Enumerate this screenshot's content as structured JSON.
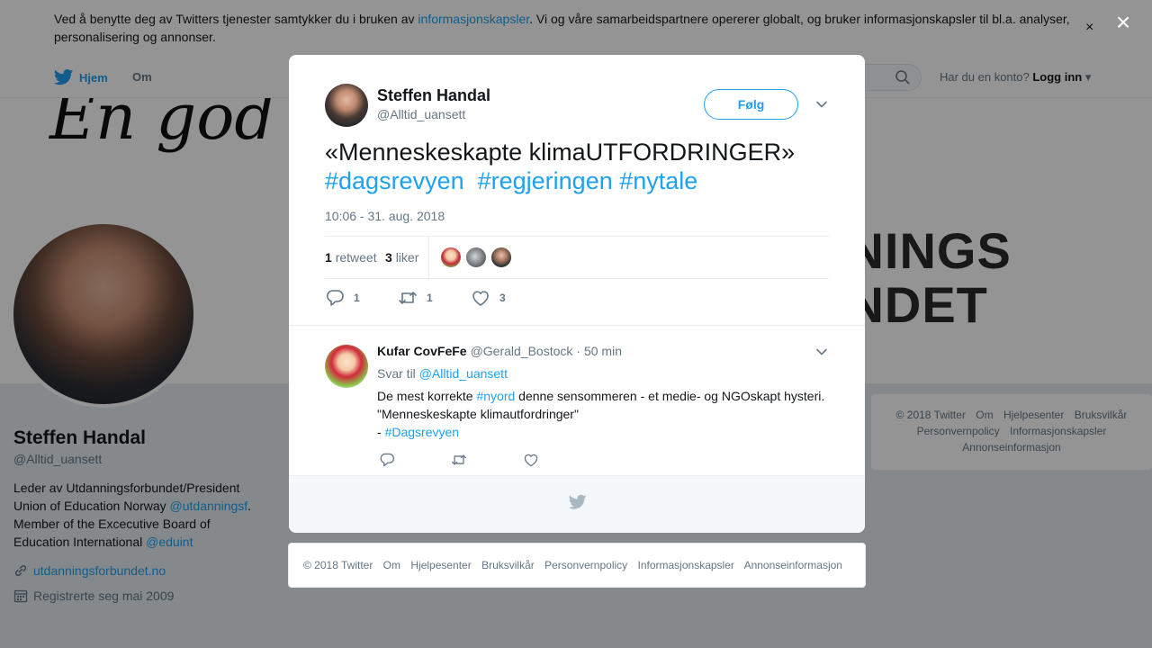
{
  "cookie_bar": {
    "text_before": "Ved å benytte deg av Twitters tjenester samtykker du i bruken av ",
    "link": "informasjonskapsler",
    "text_after": ". Vi og våre samarbeidspartnere opererer globalt, og bruker informasjonskapsler til bl.a. analyser, personalisering og annonser.",
    "close_icon": "×"
  },
  "topnav": {
    "home": "Hjem",
    "about": "Om",
    "login_prompt": "Har du en konto?",
    "login": "Logg inn"
  },
  "cover": {
    "script_text": "En god t",
    "logo_line1": "NNINGS",
    "logo_line2": "UNDET"
  },
  "profile": {
    "name": "Steffen Handal",
    "handle": "@Alltid_uansett",
    "bio_before": "Leder av Utdanningsforbundet/President Union of Education Norway ",
    "bio_link1": "@utdanningsf",
    "bio_middle": ". Member of the Excecutive Board of Education International ",
    "bio_link2": "@eduint",
    "url": "utdanningsforbundet.no",
    "joined": "Registrerte seg mai 2009"
  },
  "side_footer": [
    "© 2018 Twitter",
    "Om",
    "Hjelpesenter",
    "Bruksvilkår",
    "Personvernpolicy",
    "Informasjonskapsler",
    "Annonseinformasjon"
  ],
  "overlay": {
    "close_icon": "×"
  },
  "tweet": {
    "author_name": "Steffen Handal",
    "author_handle": "@Alltid_uansett",
    "follow_label": "Følg",
    "text_main": "«Menneskeskapte klimaUTFORDRINGER»",
    "hashtag1": "#dagsrevyen",
    "hashtag2": "#regjeringen",
    "hashtag3": "#nytale",
    "timestamp": "10:06 - 31. aug. 2018",
    "retweets_count": "1",
    "retweets_label": "retweet",
    "likes_count": "3",
    "likes_label": "liker",
    "reply_count": "1",
    "retweet_action_count": "1",
    "like_action_count": "3"
  },
  "reply": {
    "name": "Kufar CovFeFe",
    "handle": "@Gerald_Bostock",
    "time": "· 50 min",
    "reply_to_label": "Svar til",
    "reply_to_handle": "@Alltid_uansett",
    "text_before": "De mest korrekte ",
    "text_link": "#nyord",
    "text_after": " denne sensommeren - et medie- og NGOskapt hysteri. \"Menneskeskapte klimautfordringer\"",
    "line3_prefix": "- ",
    "line3_link": "#Dagsrevyen"
  },
  "modal_footer": [
    "© 2018 Twitter",
    "Om",
    "Hjelpesenter",
    "Bruksvilkår",
    "Personvernpolicy",
    "Informasjonskapsler",
    "Annonseinformasjon"
  ],
  "colors": {
    "accent": "#1da1f2",
    "secondary_text": "#657786",
    "divider": "#e6ecf0"
  }
}
